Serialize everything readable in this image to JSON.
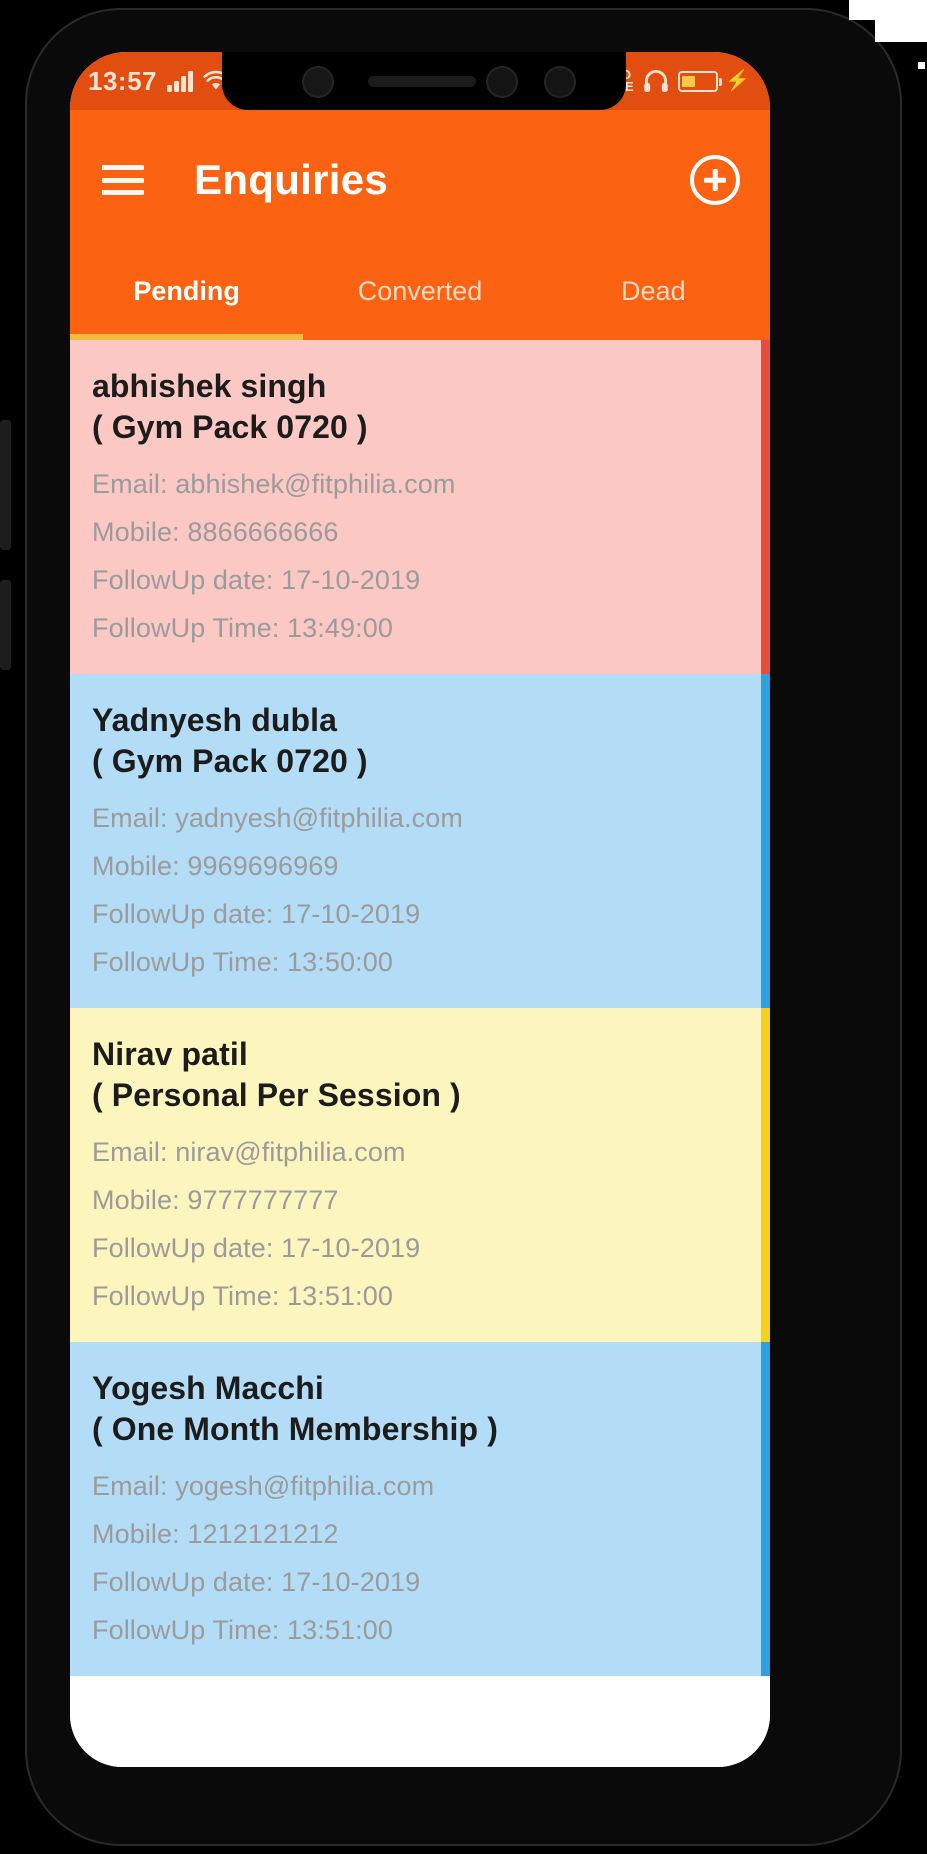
{
  "statusbar": {
    "time": "13:57",
    "signal_icon": "signal-bars-icon",
    "wifi_icon": "wifi-icon",
    "volte_line1": "VO",
    "volte_line2": "LTE",
    "headphone_icon": "headphones-icon",
    "battery_icon": "battery-icon",
    "charging_icon": "charging-bolt-icon"
  },
  "appbar": {
    "menu_icon": "hamburger-menu-icon",
    "title": "Enquiries",
    "add_icon": "add-circle-icon"
  },
  "tabs": [
    {
      "label": "Pending",
      "active": true
    },
    {
      "label": "Converted",
      "active": false
    },
    {
      "label": "Dead",
      "active": false
    }
  ],
  "colors": {
    "appbar": "#fb6312",
    "statusbar": "#e24d10",
    "tab_indicator": "#f5bb3c",
    "card_pink": "#fbc8c4",
    "card_pink_accent": "#e84c3d",
    "card_blue": "#b3dcf7",
    "card_blue_accent": "#2f9fe0",
    "card_yellow": "#fcf5bd",
    "card_yellow_accent": "#f2d21a"
  },
  "enquiries": [
    {
      "name": "abhishek singh",
      "pack": "( Gym Pack 0720 )",
      "email": "Email: abhishek@fitphilia.com",
      "mobile": "Mobile: 8866666666",
      "followup_date": "FollowUp date: 17-10-2019",
      "followup_time": "FollowUp Time: 13:49:00",
      "color": "pink"
    },
    {
      "name": "Yadnyesh dubla",
      "pack": "( Gym Pack 0720 )",
      "email": "Email: yadnyesh@fitphilia.com",
      "mobile": "Mobile: 9969696969",
      "followup_date": "FollowUp date: 17-10-2019",
      "followup_time": "FollowUp Time: 13:50:00",
      "color": "blue"
    },
    {
      "name": "Nirav patil",
      "pack": "( Personal Per Session )",
      "email": "Email: nirav@fitphilia.com",
      "mobile": "Mobile: 9777777777",
      "followup_date": "FollowUp date: 17-10-2019",
      "followup_time": "FollowUp Time: 13:51:00",
      "color": "yellow"
    },
    {
      "name": "Yogesh Macchi",
      "pack": "( One Month Membership )",
      "email": "Email: yogesh@fitphilia.com",
      "mobile": "Mobile: 1212121212",
      "followup_date": "FollowUp date: 17-10-2019",
      "followup_time": "FollowUp Time: 13:51:00",
      "color": "blue"
    }
  ]
}
